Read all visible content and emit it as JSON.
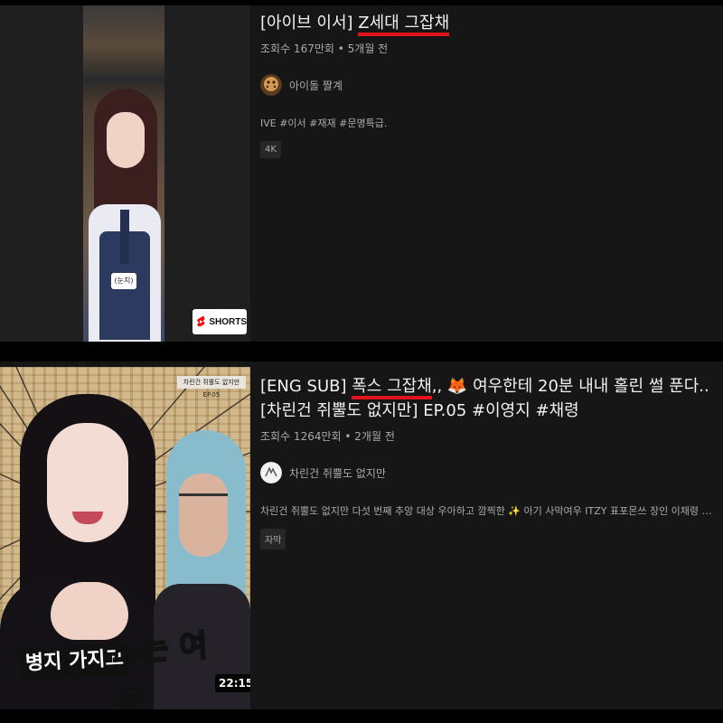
{
  "results": [
    {
      "type": "shorts",
      "title_prefix": "[아이브 이서] ",
      "title_highlight": "Z세대 그잡채",
      "title_suffix": "",
      "views": "조회수 167만회",
      "age": "5개월 전",
      "channel": "아이돌 짤계",
      "description": "IVE #이서 #재재 #문명특급.",
      "badge": "4K",
      "thumbnail_badge": "SHORTS",
      "thumbnail_tag": "(눈치)"
    },
    {
      "type": "video",
      "title_prefix": "[ENG SUB] ",
      "title_highlight": "폭스 그잡채",
      "title_suffix": ",, 🦊 여우한테 20분 내내 홀린 썰 푼다.. [차린건 쥐뿔도 없지만] EP.05 #이영지 #채령",
      "views": "조회수 1264만회",
      "age": "2개월 전",
      "channel": "차린건 쥐뿔도 없지만",
      "description": "차린건 쥐뿔도 없지만 다섯 번째 추앙 대상 우아하고 깜찍한 ✨ 아기 사막여우 ITZY 표포몬쓰 장인 이채령 주의 ...",
      "badge": "자막",
      "duration": "22:15",
      "thumbnail_caption_white": "병지 가지고",
      "thumbnail_caption_orange": "노는 여우",
      "thumbnail_tag": "차린건 쥐뿔도 없지만 EP.05"
    }
  ],
  "colors": {
    "highlight_underline": "#e3131c",
    "background": "#161616",
    "meta_text": "#aaaaaa"
  }
}
